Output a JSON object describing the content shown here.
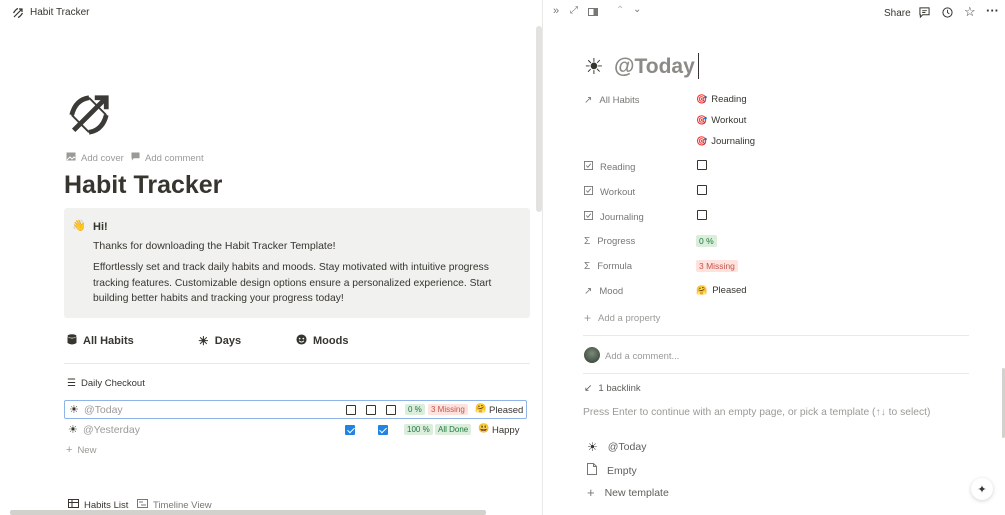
{
  "left": {
    "topbar_title": "Habit Tracker",
    "add_cover": "Add cover",
    "add_comment": "Add comment",
    "page_title": "Habit Tracker",
    "callout": {
      "heading": "Hi!",
      "line1": "Thanks for downloading the Habit Tracker Template!",
      "paragraph_l1": "Effortlessly set and track daily habits and moods. Stay motivated with intuitive progress",
      "paragraph_l2": "tracking features. Customizable design options ensure a personalized experience. Start",
      "paragraph_l3": "building better habits and tracking your progress today!"
    },
    "tabs": [
      "All Habits",
      "Days",
      "Moods"
    ],
    "view_title": "Daily Checkout",
    "rows": [
      {
        "name": "@Today",
        "checks": [
          false,
          false,
          false
        ],
        "progress": "0 %",
        "formula": "3 Missing",
        "mood_emoji": "🤗",
        "mood": "Pleased"
      },
      {
        "name": "@Yesterday",
        "checks": [
          true,
          true,
          true
        ],
        "progress": "100 %",
        "formula": "All Done",
        "mood_emoji": "😃",
        "mood": "Happy"
      }
    ],
    "new_label": "New",
    "bottom_tabs": [
      "Habits List",
      "Timeline View"
    ]
  },
  "right": {
    "share": "Share",
    "title": "@Today",
    "properties": {
      "all_habits_label": "All Habits",
      "all_habits": [
        "Reading",
        "Workout",
        "Journaling"
      ],
      "reading_label": "Reading",
      "workout_label": "Workout",
      "journaling_label": "Journaling",
      "progress_label": "Progress",
      "progress_value": "0 %",
      "formula_label": "Formula",
      "formula_value": "3 Missing",
      "mood_label": "Mood",
      "mood_emoji": "🤗",
      "mood_value": "Pleased",
      "add_property": "Add a property"
    },
    "comment_placeholder": "Add a comment...",
    "backlink": "1 backlink",
    "hint": "Press Enter to continue with an empty page, or pick a template (↑↓ to select)",
    "templates": [
      "@Today",
      "Empty",
      "New template"
    ]
  },
  "colors": {
    "accent": "#2383e2",
    "callout_bg": "#f1f1ef",
    "green_pill": "#dbeddb",
    "red_pill": "#ffe2dd"
  },
  "icons": [
    "bow-arrow-icon",
    "image-icon",
    "comment-icon",
    "sun-icon",
    "database-icon",
    "smile-icon",
    "list-icon",
    "checkbox-icon",
    "sigma-icon",
    "arrow-up-right-icon",
    "plus-icon",
    "document-icon",
    "sparkle-icon",
    "clock-icon",
    "star-icon",
    "more-icon"
  ]
}
